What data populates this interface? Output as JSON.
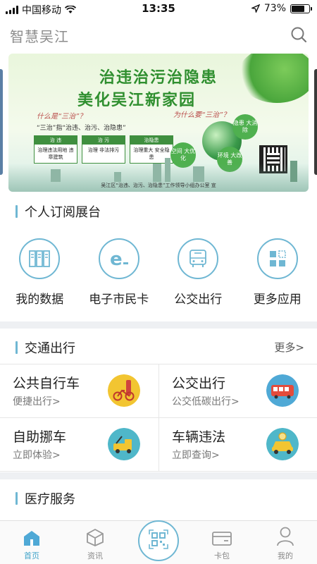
{
  "status": {
    "carrier": "中国移动",
    "time": "13:35",
    "battery": "73%",
    "battery_level": 0.73
  },
  "header": {
    "title": "智慧吴江"
  },
  "banner": {
    "headline1": "治违治污治隐患",
    "headline2": "美化吴江新家园",
    "question1": "什么是“三治”？",
    "question2": "为什么要“三治”？",
    "definition": "“三治”指“治违、治污、治隐患”",
    "boxes": [
      {
        "head": "治 违",
        "body": "治理违法用地 违章建筑"
      },
      {
        "head": "治 污",
        "body": "治理 非法排污"
      },
      {
        "head": "治隐患",
        "body": "治理重大 安全隐患"
      }
    ],
    "bubbles": [
      "空间 大优化",
      "环境 大改善",
      "隐患 大消除"
    ],
    "footer": "吴江区“治违、治污、治隐患”工作领导小组办公室 宣"
  },
  "personal": {
    "title": "个人订阅展台",
    "items": [
      {
        "label": "我的数据",
        "icon": "database-icon"
      },
      {
        "label": "电子市民卡",
        "icon": "e-card-icon"
      },
      {
        "label": "公交出行",
        "icon": "bus-icon"
      },
      {
        "label": "更多应用",
        "icon": "apps-grid-icon"
      }
    ]
  },
  "traffic": {
    "title": "交通出行",
    "more": "更多>",
    "cards": [
      {
        "title": "公共自行车",
        "sub": "便捷出行>",
        "icon": "bicycle-icon"
      },
      {
        "title": "公交出行",
        "sub": "公交低碳出行>",
        "icon": "bus-front-icon"
      },
      {
        "title": "自助挪车",
        "sub": "立即体验>",
        "icon": "tow-truck-icon"
      },
      {
        "title": "车辆违法",
        "sub": "立即查询>",
        "icon": "taxi-icon"
      }
    ]
  },
  "medical": {
    "title": "医疗服务"
  },
  "tabbar": {
    "items": [
      {
        "label": "首页",
        "icon": "home-icon"
      },
      {
        "label": "资讯",
        "icon": "cube-icon"
      },
      {
        "label": "",
        "icon": "qr-scan-icon"
      },
      {
        "label": "卡包",
        "icon": "wallet-icon"
      },
      {
        "label": "我的",
        "icon": "user-icon"
      }
    ]
  },
  "colors": {
    "accent": "#3fa3c9",
    "bar": "#6fb7d3",
    "banner_green": "#2f8f2f"
  }
}
